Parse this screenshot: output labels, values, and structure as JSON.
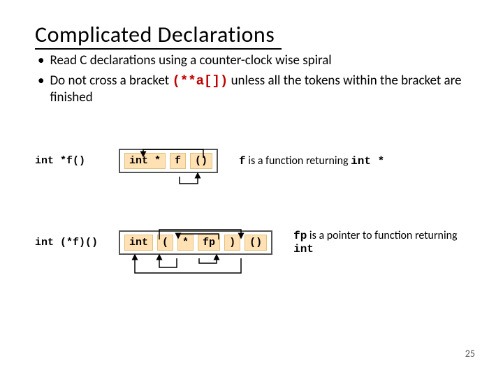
{
  "title": "Complicated  Declarations",
  "bullets": [
    {
      "pre": "Read C declarations using a counter-clock wise spiral",
      "code": "",
      "post": ""
    },
    {
      "pre": "Do not cross a bracket ",
      "code": "(**a[])",
      "post": " unless all the tokens within the bracket are finished"
    }
  ],
  "ex1": {
    "decl": "int *f()",
    "tokens": [
      "int *",
      "f",
      "()"
    ],
    "desc_lead_code": "f",
    "desc_mid": " is a function returning  ",
    "desc_trail_code": "int *"
  },
  "ex2": {
    "decl": "int (*f)()",
    "tokens": [
      "int",
      "(",
      "*",
      "fp",
      ")",
      "()"
    ],
    "desc_lead_code": "fp",
    "desc_mid": " is a pointer to function returning  ",
    "desc_trail_code": "int"
  },
  "page_number": "25"
}
